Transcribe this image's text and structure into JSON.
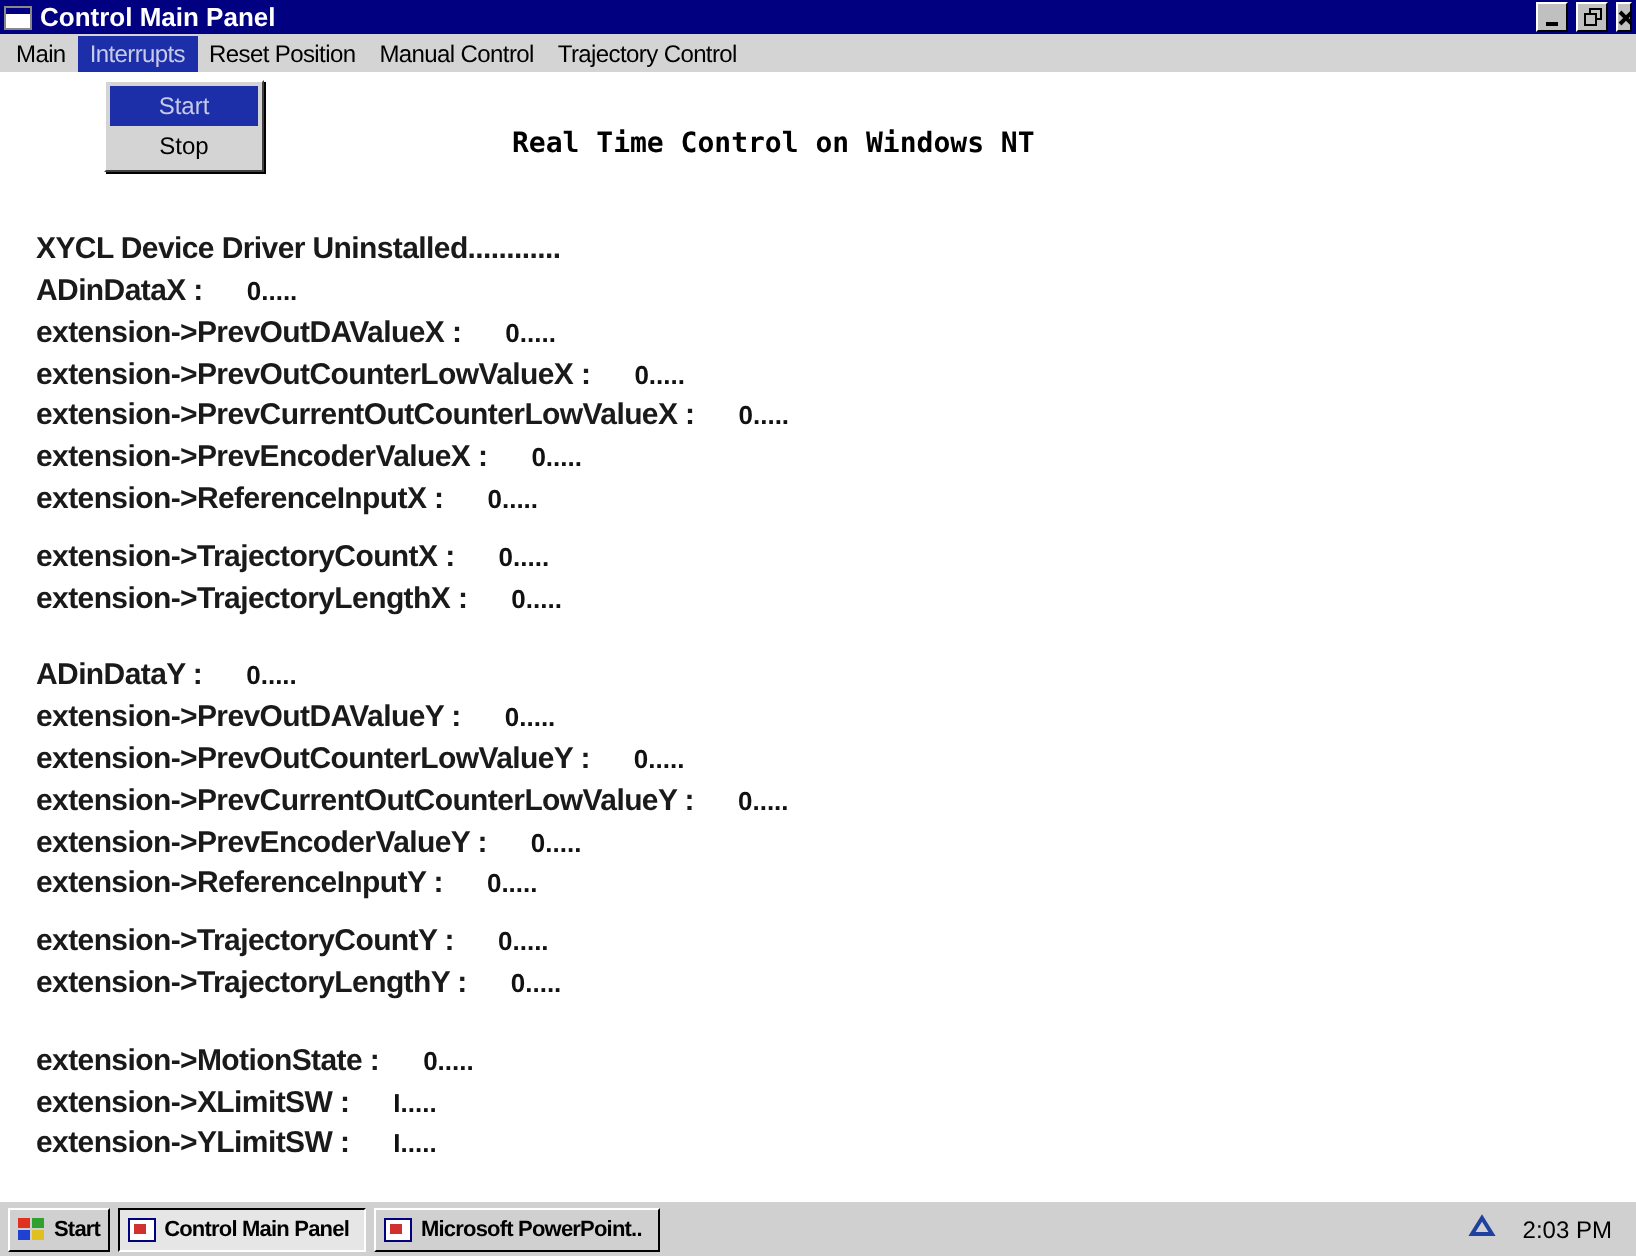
{
  "window": {
    "title": "Control Main Panel"
  },
  "menu": [
    {
      "label": "Main",
      "selected": false
    },
    {
      "label": "Interrupts",
      "selected": true
    },
    {
      "label": "Reset Position",
      "selected": false
    },
    {
      "label": "Manual Control",
      "selected": false
    },
    {
      "label": "Trajectory Control",
      "selected": false
    }
  ],
  "dropdown": [
    {
      "label": "Start",
      "selected": true
    },
    {
      "label": "Stop",
      "selected": false
    }
  ],
  "heading": "Real Time Control on Windows NT",
  "sections": [
    {
      "blocks": [
        [
          {
            "label": "XYCL Device Driver Uninstalled............"
          },
          {
            "label": "ADinDataX  :",
            "value": "0....."
          },
          {
            "label": "extension->PrevOutDAValueX :",
            "value": "0....."
          },
          {
            "label": "extension->PrevOutCounterLowValueX :",
            "value": "0....."
          },
          {
            "label": "extension->PrevCurrentOutCounterLowValueX :",
            "value": "0....."
          },
          {
            "label": "extension->PrevEncoderValueX :",
            "value": "0....."
          },
          {
            "label": "extension->ReferenceInputX :",
            "value": "0....."
          }
        ],
        [
          {
            "label": "extension->TrajectoryCountX :",
            "value": "0....."
          },
          {
            "label": "extension->TrajectoryLengthX :",
            "value": "0....."
          }
        ]
      ]
    },
    {
      "blocks": [
        [
          {
            "label": "ADinDataY  :",
            "value": "0....."
          },
          {
            "label": "extension->PrevOutDAValueY :",
            "value": "0....."
          },
          {
            "label": "extension->PrevOutCounterLowValueY :",
            "value": "0....."
          },
          {
            "label": "extension->PrevCurrentOutCounterLowValueY :",
            "value": "0....."
          },
          {
            "label": "extension->PrevEncoderValueY :",
            "value": "0....."
          },
          {
            "label": "extension->ReferenceInputY :",
            "value": "0....."
          }
        ],
        [
          {
            "label": "extension->TrajectoryCountY :",
            "value": "0....."
          },
          {
            "label": "extension->TrajectoryLengthY :",
            "value": "0....."
          }
        ]
      ]
    },
    {
      "blocks": [
        [
          {
            "label": "extension->MotionState :",
            "value": "0....."
          },
          {
            "label": "extension->XLimitSW :",
            "value": "I....."
          },
          {
            "label": "extension->YLimitSW :",
            "value": "I....."
          }
        ]
      ]
    }
  ],
  "taskbar": {
    "start": "Start",
    "tasks": [
      {
        "label": "Control Main Panel",
        "selected": true
      },
      {
        "label": "Microsoft PowerPoint..",
        "selected": false
      }
    ],
    "clock": "2:03 PM"
  }
}
